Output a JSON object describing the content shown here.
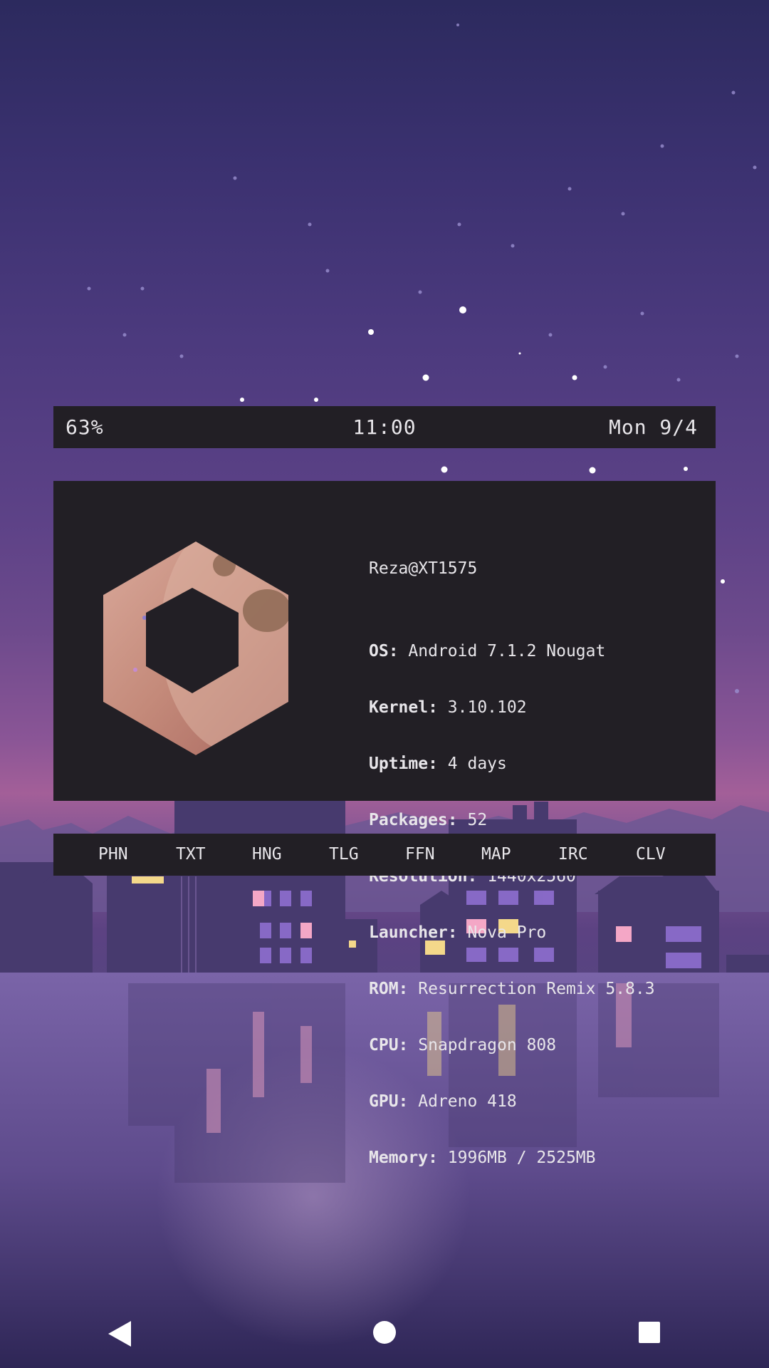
{
  "status": {
    "battery": "63%",
    "time": "11:00",
    "date": "Mon 9/4"
  },
  "sysinfo": {
    "user_host": "Reza@XT1575",
    "rows": [
      {
        "key": "OS:",
        "value": "Android 7.1.2 Nougat"
      },
      {
        "key": "Kernel:",
        "value": "3.10.102"
      },
      {
        "key": "Uptime:",
        "value": "4 days"
      },
      {
        "key": "Packages:",
        "value": "52"
      },
      {
        "key": "Resolution:",
        "value": "1440x2560"
      },
      {
        "key": "Launcher:",
        "value": "Nova Pro"
      },
      {
        "key": "ROM:",
        "value": "Resurrection Remix 5.8.3"
      },
      {
        "key": "CPU:",
        "value": "Snapdragon 808"
      },
      {
        "key": "GPU:",
        "value": "Adreno 418"
      },
      {
        "key": "Memory:",
        "value": "1996MB / 2525MB"
      }
    ],
    "logo_icon": "hexagon-moon-logo-icon"
  },
  "dock": {
    "items": [
      "PHN",
      "TXT",
      "HNG",
      "TLG",
      "FFN",
      "MAP",
      "IRC",
      "CLV"
    ]
  },
  "navbar": {
    "back_icon": "back-triangle-icon",
    "home_icon": "home-circle-icon",
    "recents_icon": "recents-square-icon"
  },
  "colors": {
    "panel_bg": "#221f25",
    "panel_text": "#e8e6ea",
    "sky_top": "#2c2a5e",
    "sky_horizon": "#a35f98"
  }
}
